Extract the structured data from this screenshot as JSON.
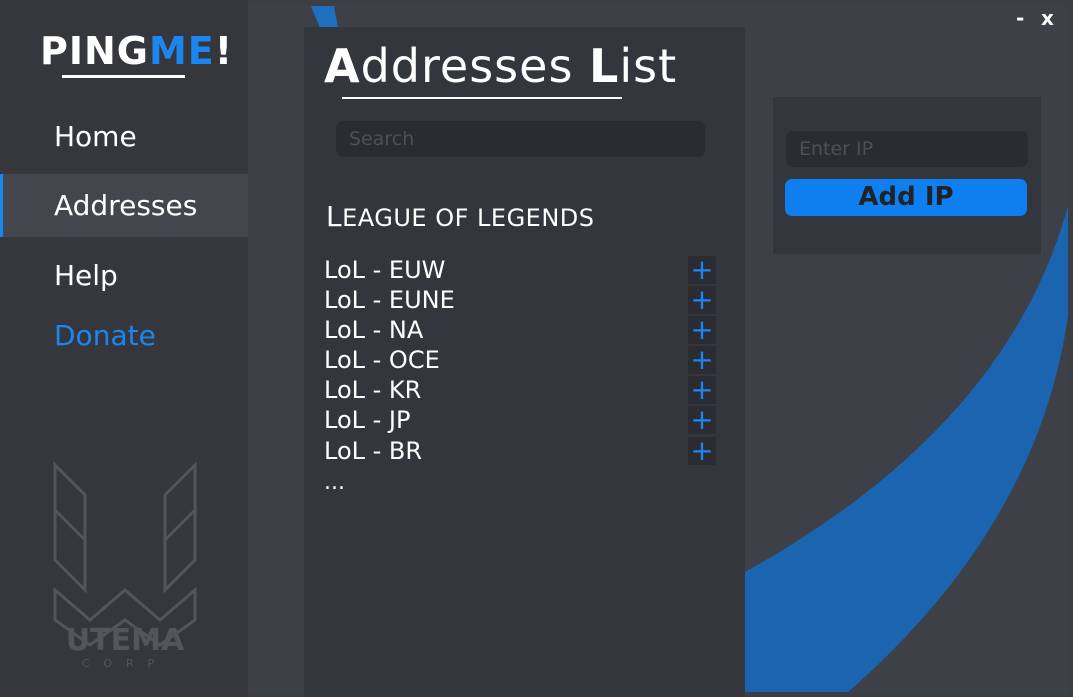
{
  "app": {
    "logo_main": "PING",
    "logo_accent": "ME",
    "logo_suffix": "!",
    "accent_color": "#1c86f0"
  },
  "window_controls": {
    "minimize_icon": "minimize-icon",
    "minimize_label": "-",
    "close_icon": "close-icon",
    "close_label": "x"
  },
  "sidebar": {
    "items": [
      {
        "label": "Home",
        "active": false
      },
      {
        "label": "Addresses",
        "active": true
      },
      {
        "label": "Help",
        "active": false
      },
      {
        "label": "Donate",
        "active": false
      }
    ],
    "corp_logo_text": "UTEMA",
    "corp_logo_sub": "CORP"
  },
  "main": {
    "title_first": "A",
    "title_rest1": "ddresses ",
    "title_second": "L",
    "title_rest2": "ist",
    "search_placeholder": "Search",
    "section_first": "L",
    "section_rest": "EAGUE OF LEGENDS",
    "servers": [
      {
        "name": "LoL - EUW",
        "action": "+"
      },
      {
        "name": "LoL - EUNE",
        "action": "+"
      },
      {
        "name": "LoL - NA",
        "action": "+"
      },
      {
        "name": "LoL - OCE",
        "action": "+"
      },
      {
        "name": "LoL - KR",
        "action": "+"
      },
      {
        "name": "LoL - JP",
        "action": "+"
      },
      {
        "name": "LoL - BR",
        "action": "+"
      }
    ],
    "more": "..."
  },
  "add_panel": {
    "ip_placeholder": "Enter IP",
    "add_button": "Add IP"
  }
}
